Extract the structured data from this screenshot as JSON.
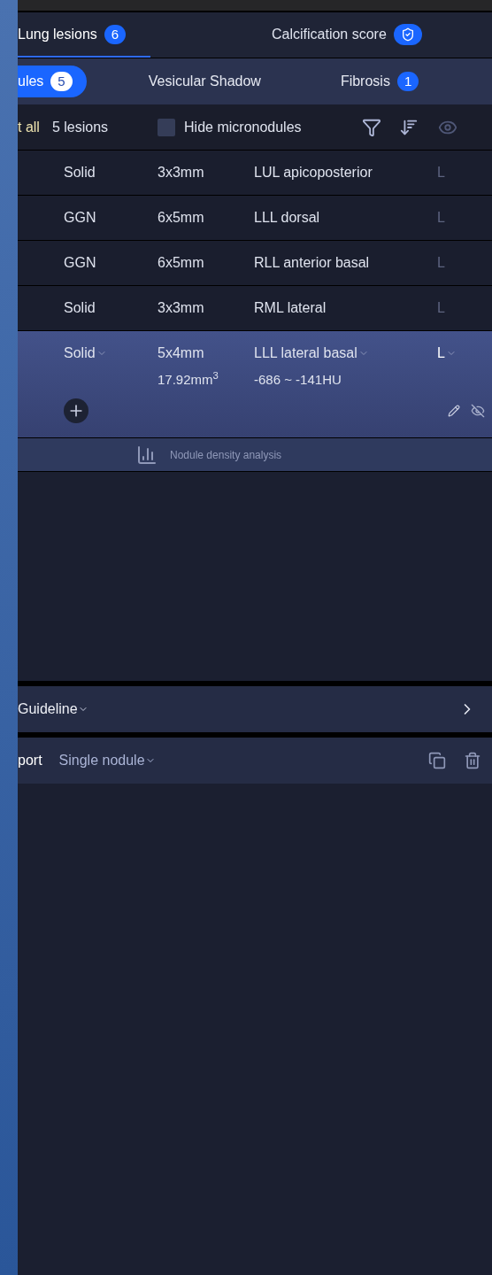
{
  "tabs": [
    {
      "kind": "count",
      "label": "Lung lesions",
      "badge": "6",
      "selected": true
    },
    {
      "kind": "shield",
      "label": "Calcification score",
      "selected": false
    }
  ],
  "subtabs": [
    {
      "label": "ules",
      "badge": "5",
      "selected": true
    },
    {
      "label": "Vesicular Shadow",
      "selected": false
    },
    {
      "label": "Fibrosis",
      "badge": "1",
      "selected": false
    }
  ],
  "toolbar": {
    "select_all": "t all",
    "count": "5 lesions",
    "hide_micronodules": {
      "label": "Hide micronodules",
      "checked": false
    }
  },
  "lesions": [
    {
      "type": "Solid",
      "size": "3x3mm",
      "location": "LUL apicoposterior",
      "side": "L",
      "selected": false
    },
    {
      "type": "GGN",
      "size": "6x5mm",
      "location": "LLL dorsal",
      "side": "L",
      "selected": false
    },
    {
      "type": "GGN",
      "size": "6x5mm",
      "location": "RLL anterior basal",
      "side": "L",
      "selected": false
    },
    {
      "type": "Solid",
      "size": "3x3mm",
      "location": "RML lateral",
      "side": "L",
      "selected": false
    },
    {
      "type": "Solid",
      "size": "5x4mm",
      "location": "LLL lateral basal",
      "side": "L",
      "selected": true,
      "volume": "17.92mm$^{3}$",
      "density": "-686 ~ -141HU"
    }
  ],
  "analysis_link": "Nodule density analysis",
  "guideline": {
    "label": "Guideline"
  },
  "report": {
    "label": "port",
    "mode": "Single nodule"
  }
}
